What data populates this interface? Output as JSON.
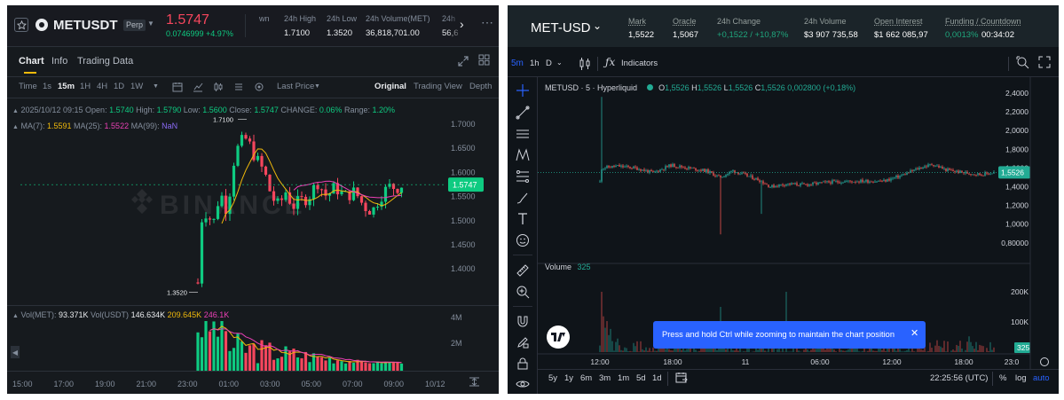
{
  "left": {
    "header": {
      "symbol": "METUSDT",
      "badge": "Perp",
      "price": "1.5747",
      "change": "0.0746999 +4.97%",
      "partial_label": "wn",
      "stats": [
        {
          "label": "24h High",
          "value": "1.7100"
        },
        {
          "label": "24h Low",
          "value": "1.3520"
        },
        {
          "label": "24h Volume(MET)",
          "value": "36,818,701.00"
        },
        {
          "label": "24h",
          "value": "56,6"
        }
      ]
    },
    "tabs": [
      "Chart",
      "Info",
      "Trading Data"
    ],
    "toolbar": {
      "time_label": "Time",
      "timeframes": [
        "1s",
        "15m",
        "1H",
        "4H",
        "1D",
        "1W"
      ],
      "active_timeframe": "15m",
      "price_type": "Last Price",
      "views": [
        "Original",
        "Trading View",
        "Depth"
      ],
      "active_view": "Original"
    },
    "ohlc": {
      "date": "2025/10/12 09:15",
      "open_label": "Open:",
      "open": "1.5740",
      "high_label": "High:",
      "high": "1.5790",
      "low_label": "Low:",
      "low": "1.5600",
      "close_label": "Close:",
      "close": "1.5747",
      "change_label": "CHANGE:",
      "change": "0.06%",
      "range_label": "Range:",
      "range": "1.20%"
    },
    "ma": {
      "ma7_label": "MA(7):",
      "ma7": "1.5591",
      "ma25_label": "MA(25):",
      "ma25": "1.5522",
      "ma99_label": "MA(99):",
      "ma99": "NaN"
    },
    "watermark": "BINANCE",
    "price_axis": [
      "1.7000",
      "1.6500",
      "1.6000",
      "1.5500",
      "1.5000",
      "1.4500",
      "1.4000"
    ],
    "last_price_tag": "1.5747",
    "high_marker": "1.7100",
    "low_marker": "1.3520",
    "volume": {
      "label": "Vol(MET):",
      "value": "93.371K",
      "usdt_label": "Vol(USDT)",
      "usdt_value": "146.634K",
      "ma1": "209.645K",
      "ma2": "246.1K",
      "axis": [
        "4M",
        "2M"
      ]
    },
    "time_axis": [
      "15:00",
      "17:00",
      "19:00",
      "21:00",
      "23:00",
      "01:00",
      "03:00",
      "05:00",
      "07:00",
      "09:00",
      "10/12"
    ],
    "colors": {
      "up": "#0ecb81",
      "down": "#f6465d",
      "ma7": "#f0b90b",
      "ma25": "#eb40b5",
      "bg": "#161a1e"
    }
  },
  "right": {
    "header": {
      "symbol": "MET-USD",
      "stats": [
        {
          "label": "Mark",
          "value": "1,5522"
        },
        {
          "label": "Oracle",
          "value": "1,5067"
        },
        {
          "label": "24h Change",
          "value": "+0,1522 / +10,87%"
        },
        {
          "label": "24h Volume",
          "value": "$3 907 735,58"
        },
        {
          "label": "Open Interest",
          "value": "$1 662 085,97"
        },
        {
          "label": "Funding / Countdown",
          "value": "0,0013%",
          "value2": "00:34:02"
        }
      ]
    },
    "toolbar": {
      "intervals": [
        "5m",
        "1h",
        "D"
      ],
      "active_interval": "5m",
      "indicators_label": "Indicators"
    },
    "legend": {
      "title": "METUSD · 5 · Hyperliquid",
      "o_label": "O",
      "o": "1,5526",
      "h_label": "H",
      "h": "1,5526",
      "l_label": "L",
      "l": "1,5526",
      "c_label": "C",
      "c": "1,5526",
      "change": "0,002800 (+0,18%)"
    },
    "price_axis": [
      "2,4000",
      "2,2000",
      "2,0000",
      "1,8000",
      "1,6000",
      "1,4000",
      "1,2000",
      "1,0000",
      "0,80000"
    ],
    "last_price_tag": "1,5526",
    "volume": {
      "label": "Volume",
      "value": "325",
      "axis": [
        "200K",
        "100K"
      ],
      "tag": "325"
    },
    "tooltip": "Press and hold Ctrl while zooming to maintain the chart position",
    "time_axis": [
      "12:00",
      "18:00",
      "11",
      "06:00",
      "12:00",
      "18:00",
      "23:0"
    ],
    "bottom": {
      "ranges": [
        "5y",
        "1y",
        "6m",
        "3m",
        "1m",
        "5d",
        "1d"
      ],
      "clock": "22:25:56 (UTC)",
      "percent": "%",
      "log": "log",
      "auto": "auto"
    },
    "colors": {
      "up": "#26a69a",
      "down": "#ef5350",
      "accent": "#1e53e5",
      "tag": "#22ab94"
    }
  }
}
